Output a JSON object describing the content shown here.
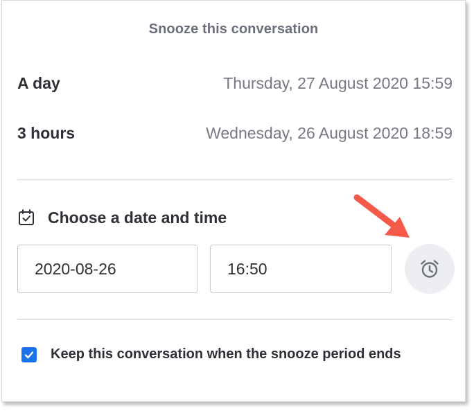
{
  "dialog": {
    "title": "Snooze this conversation",
    "options": [
      {
        "label": "A day",
        "datetime": "Thursday, 27 August 2020 15:59"
      },
      {
        "label": "3 hours",
        "datetime": "Wednesday, 26 August 2020 18:59"
      }
    ],
    "custom": {
      "heading": "Choose a date and time",
      "heading_icon": "calendar-check-icon",
      "date_value": "2020-08-26",
      "time_value": "16:50",
      "alarm_icon": "alarm-clock-icon"
    },
    "keep_conversation": {
      "label": "Keep this conversation when the snooze period ends",
      "checked": true
    }
  },
  "annotation": {
    "icon": "red-arrow-icon",
    "color": "#f4594a"
  },
  "colors": {
    "accent": "#1a73e8",
    "muted_text": "#767983",
    "text": "#2f3037"
  }
}
